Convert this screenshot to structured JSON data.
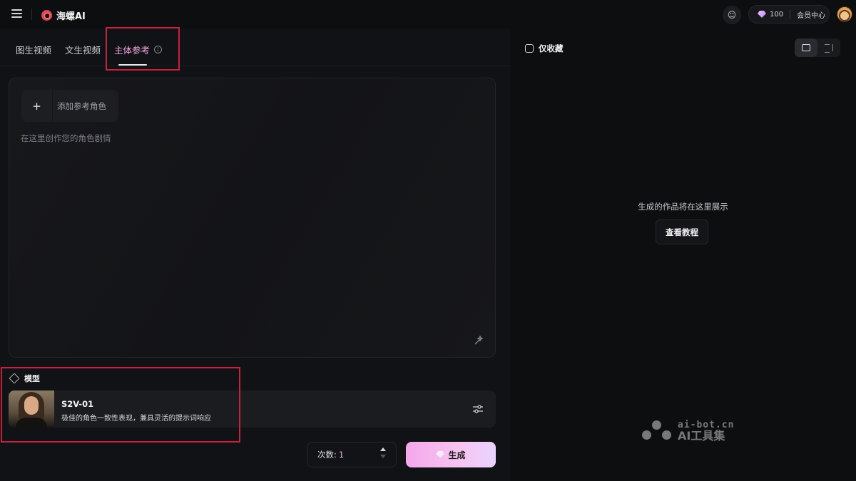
{
  "app": {
    "logo_text": "海螺AI"
  },
  "header": {
    "credits": "100",
    "member_center_label": "会员中心"
  },
  "tabs": [
    {
      "label": "图生视频"
    },
    {
      "label": "文生视频"
    },
    {
      "label": "主体参考",
      "active": true
    }
  ],
  "prompt": {
    "add_reference_label": "添加参考角色",
    "add_symbol": "+",
    "placeholder": "在这里创作您的角色剧情"
  },
  "model": {
    "section_label": "模型",
    "name": "S2V-01",
    "description": "极佳的角色一致性表现，兼具灵活的提示词响应"
  },
  "generate": {
    "count_label": "次数:",
    "count_value": "1",
    "button_label": "生成"
  },
  "gallery": {
    "favorites_only_label": "仅收藏",
    "empty_text": "生成的作品将在这里展示",
    "tutorial_button_label": "查看教程"
  },
  "watermark": {
    "url": "ai-bot.cn",
    "name": "AI工具集"
  },
  "colors": {
    "accent_pink": "#f2a9e3",
    "highlight_box": "#c8203f",
    "background": "#0d0e10"
  }
}
